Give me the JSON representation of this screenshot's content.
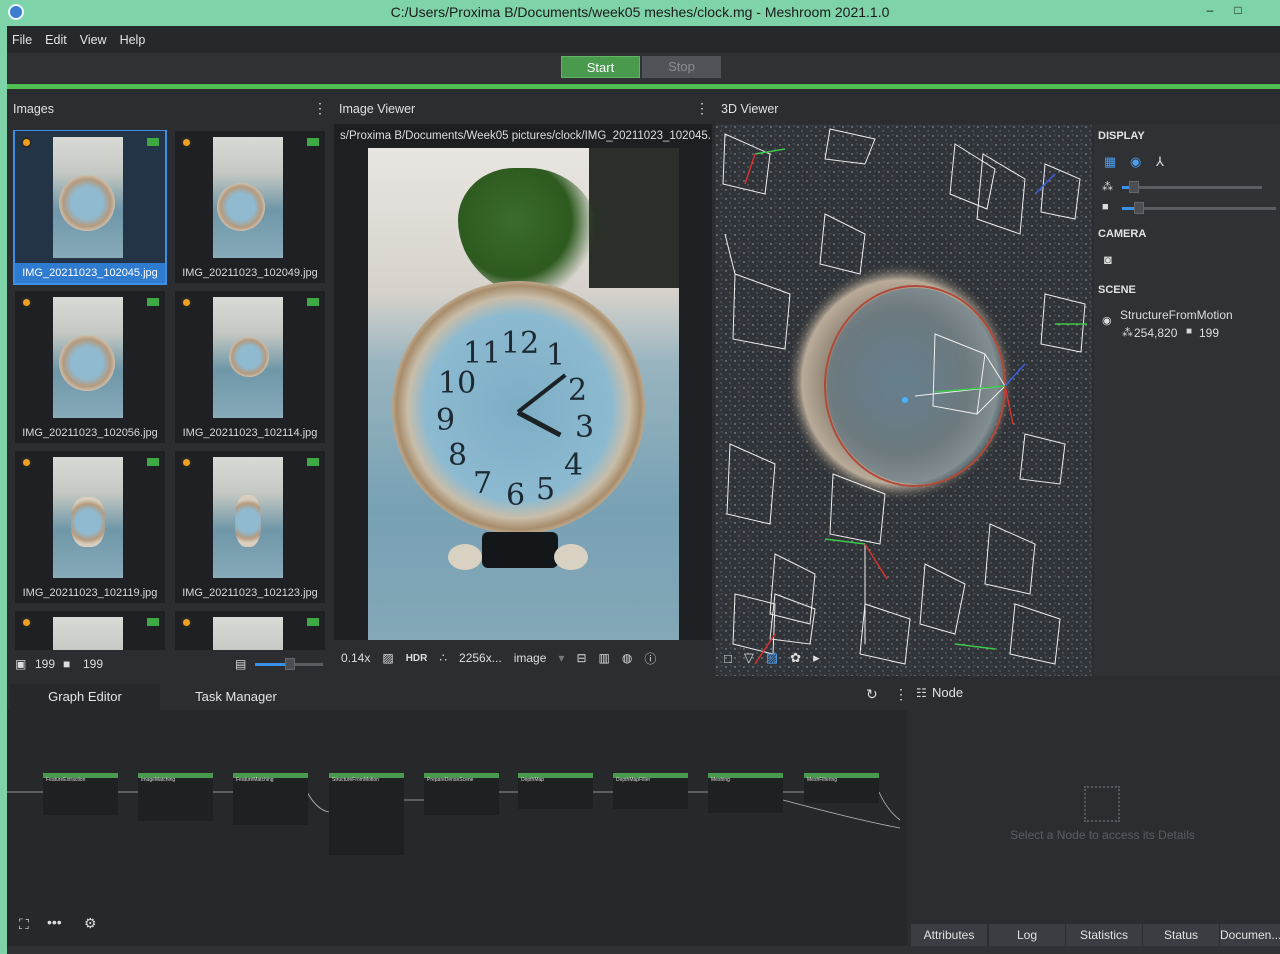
{
  "window": {
    "title": "C:/Users/Proxima B/Documents/week05 meshes/clock.mg - Meshroom 2021.1.0",
    "controls": [
      "–",
      "□"
    ]
  },
  "menu": [
    "File",
    "Edit",
    "View",
    "Help"
  ],
  "toolbar": {
    "start_label": "Start",
    "stop_label": "Stop"
  },
  "images_panel": {
    "title": "Images",
    "thumbnails": [
      {
        "name": "IMG_20211023_102045.jpg",
        "selected": true
      },
      {
        "name": "IMG_20211023_102049.jpg"
      },
      {
        "name": "IMG_20211023_102056.jpg"
      },
      {
        "name": "IMG_20211023_102114.jpg"
      },
      {
        "name": "IMG_20211023_102119.jpg"
      },
      {
        "name": "IMG_20211023_102123.jpg"
      }
    ],
    "image_count": "199",
    "camera_count": "199"
  },
  "image_viewer": {
    "title": "Image Viewer",
    "path": "s/Proxima B/Documents/Week05 pictures/clock/IMG_20211023_102045.jpg",
    "zoom": "0.14x",
    "hdr": "HDR",
    "resolution": "2256x...",
    "channel": "image",
    "clock_numerals": [
      "12",
      "1",
      "2",
      "3",
      "4",
      "5",
      "6",
      "7",
      "8",
      "9",
      "10",
      "11"
    ]
  },
  "viewer_3d": {
    "title": "3D Viewer"
  },
  "display_settings": {
    "display_label": "DISPLAY",
    "camera_label": "CAMERA",
    "scene_label": "SCENE",
    "scene_item": "StructureFromMotion",
    "points": "254,820",
    "cameras": "199"
  },
  "bottom_tabs": {
    "graph_editor": "Graph Editor",
    "task_manager": "Task Manager"
  },
  "graph_nodes": [
    "FeatureExtraction",
    "ImageMatching",
    "FeatureMatching",
    "StructureFromMotion",
    "PrepareDenseScene",
    "DepthMap",
    "DepthMapFilter",
    "Meshing",
    "MeshFiltering"
  ],
  "node_panel": {
    "title": "Node",
    "hint": "Select a Node to access its Details",
    "tabs": [
      "Attributes",
      "Log",
      "Statistics",
      "Status",
      "Documen..."
    ]
  },
  "colors": {
    "accent": "#4fbf52",
    "selection": "#2e7bd0",
    "titlebar": "#7fd3a8"
  }
}
